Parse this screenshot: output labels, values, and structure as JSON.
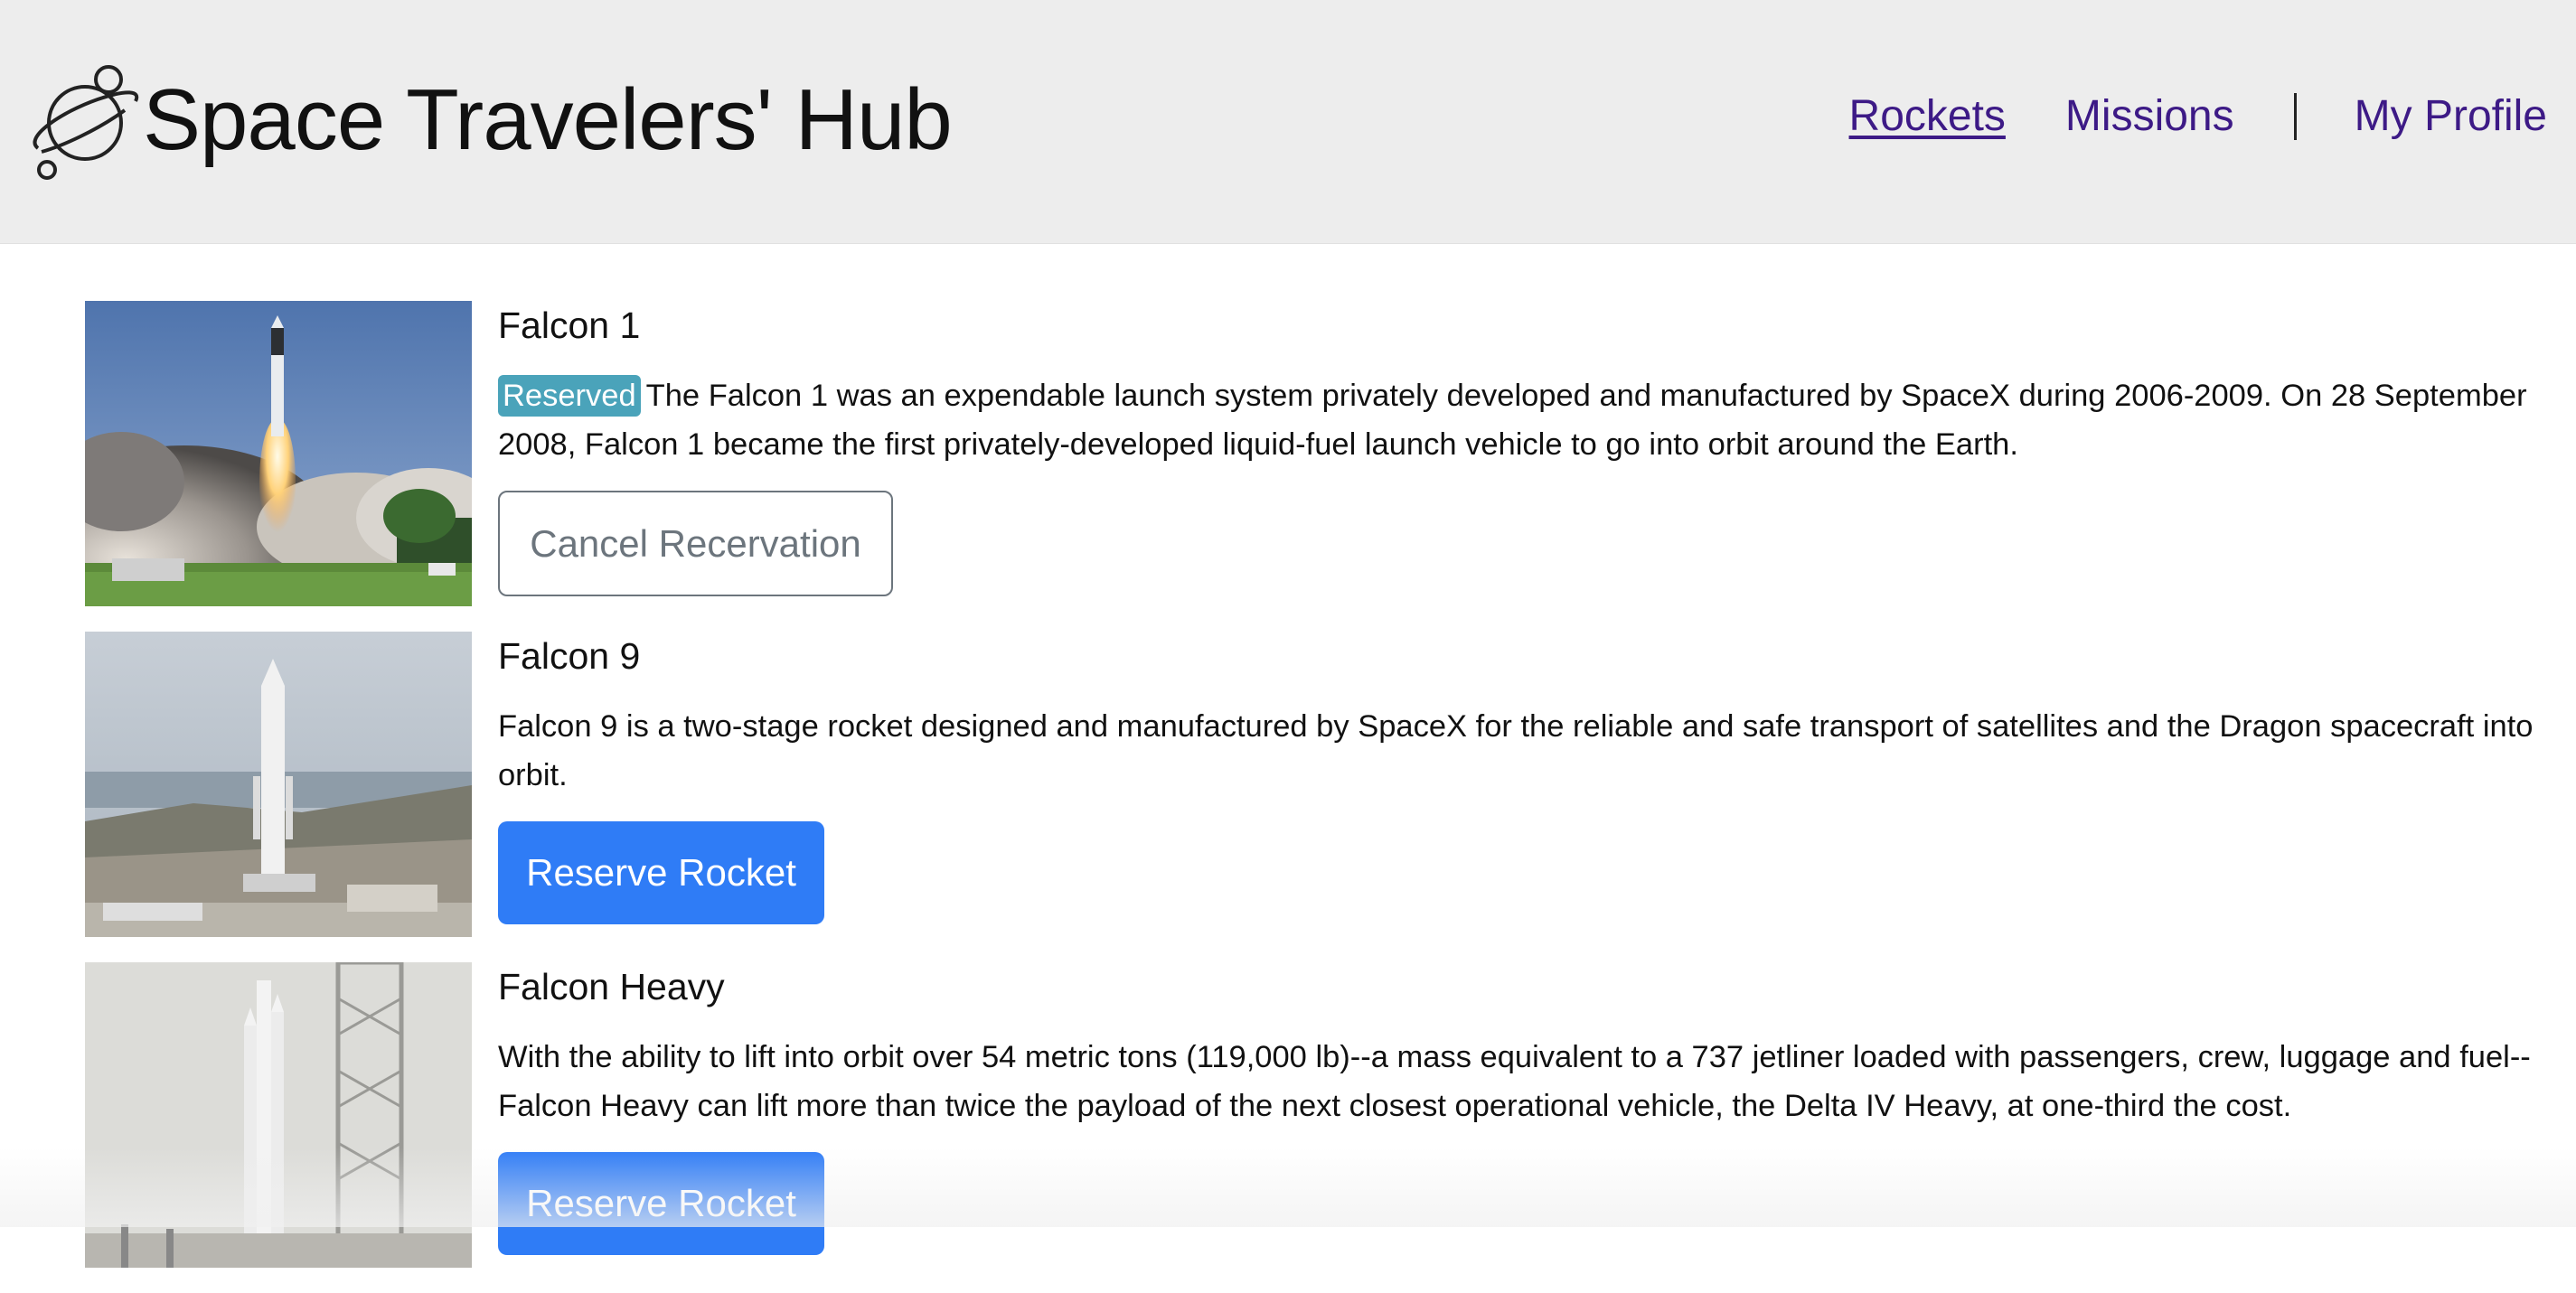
{
  "header": {
    "title": "Space Travelers' Hub",
    "logo_icon": "planet-logo-icon"
  },
  "nav": {
    "rockets": "Rockets",
    "missions": "Missions",
    "profile": "My Profile"
  },
  "rockets": [
    {
      "name": "Falcon 1",
      "reserved": true,
      "badge": "Reserved",
      "description": "The Falcon 1 was an expendable launch system privately developed and manufactured by SpaceX during 2006-2009. On 28 September 2008, Falcon 1 became the first privately-developed liquid-fuel launch vehicle to go into orbit around the Earth.",
      "button": "Cancel Recervation"
    },
    {
      "name": "Falcon 9",
      "reserved": false,
      "description": "Falcon 9 is a two-stage rocket designed and manufactured by SpaceX for the reliable and safe transport of satellites and the Dragon spacecraft into orbit.",
      "button": "Reserve Rocket"
    },
    {
      "name": "Falcon Heavy",
      "reserved": false,
      "description": "With the ability to lift into orbit over 54 metric tons (119,000 lb)--a mass equivalent to a 737 jetliner loaded with passengers, crew, luggage and fuel--Falcon Heavy can lift more than twice the payload of the next closest operational vehicle, the Delta IV Heavy, at one-third the cost.",
      "button": "Reserve Rocket"
    }
  ],
  "colors": {
    "header_bg": "#ededed",
    "nav_link": "#3d1a86",
    "badge_bg": "#4aa3ba",
    "primary_button": "#2f7cf6",
    "outline_button": "#6c757d"
  }
}
